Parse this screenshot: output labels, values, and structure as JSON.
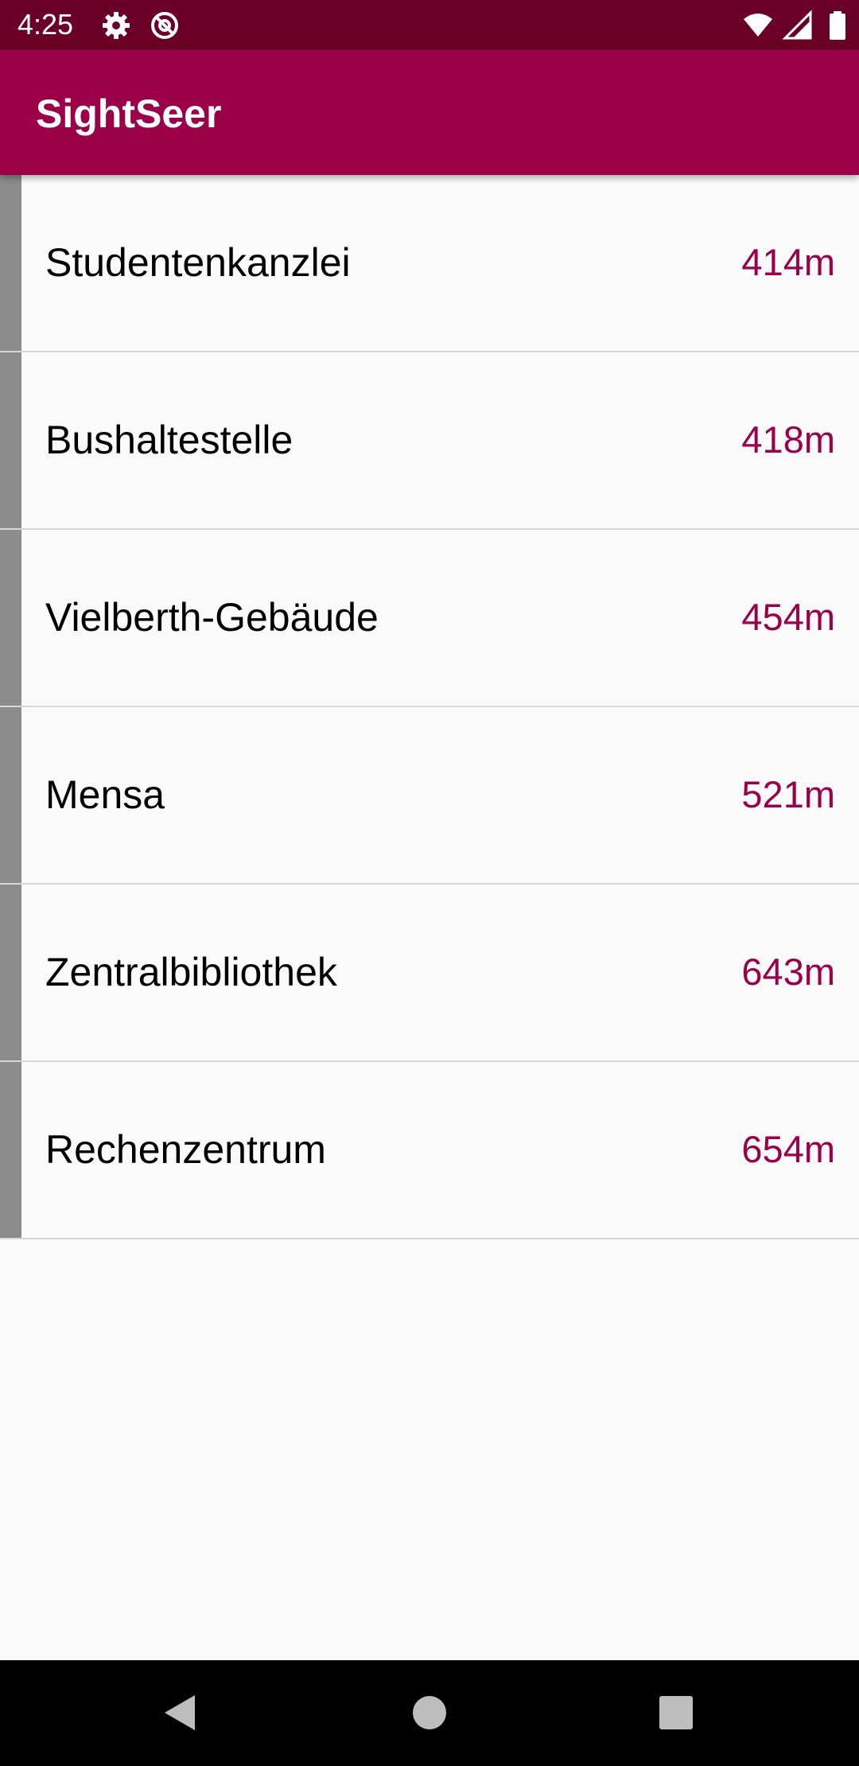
{
  "status_bar": {
    "time": "4:25",
    "icons": [
      "gear-icon",
      "at-icon",
      "wifi-icon",
      "signal-icon",
      "battery-icon"
    ]
  },
  "app_bar": {
    "title": "SightSeer"
  },
  "colors": {
    "status_bar": "#6a0026",
    "app_bar": "#9c0048",
    "accent": "#9c0048",
    "item_bar": "#8c8c8c",
    "background": "#fafafa"
  },
  "list": {
    "items": [
      {
        "name": "Studentenkanzlei",
        "distance": "414m"
      },
      {
        "name": "Bushaltestelle",
        "distance": "418m"
      },
      {
        "name": "Vielberth-Gebäude",
        "distance": "454m"
      },
      {
        "name": "Mensa",
        "distance": "521m"
      },
      {
        "name": "Zentralbibliothek",
        "distance": "643m"
      },
      {
        "name": "Rechenzentrum",
        "distance": "654m"
      }
    ]
  },
  "nav_bar": {
    "icons": [
      "back-icon",
      "home-icon",
      "recents-icon"
    ]
  }
}
